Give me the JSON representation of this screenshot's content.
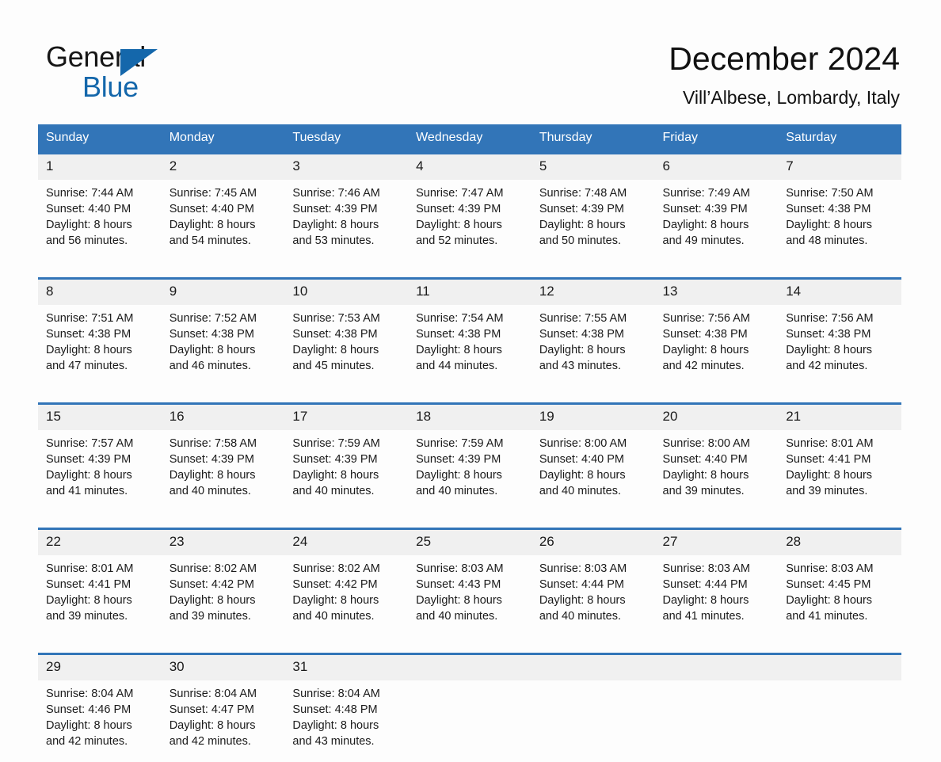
{
  "brand": {
    "word_one": "General",
    "word_two": "Blue",
    "triangle_icon": "triangle-icon",
    "accent_color": "#1467ab"
  },
  "header": {
    "title": "December 2024",
    "location": "Vill’Albese, Lombardy, Italy"
  },
  "theme": {
    "header_blue": "#3275b8",
    "daynum_band": "#f0f0f0",
    "page_background": "#fdfdfd",
    "text_color": "#1a1a1a"
  },
  "calendar": {
    "day_headers": [
      "Sunday",
      "Monday",
      "Tuesday",
      "Wednesday",
      "Thursday",
      "Friday",
      "Saturday"
    ],
    "weeks": [
      {
        "days": [
          {
            "date": "1",
            "sunrise": "Sunrise: 7:44 AM",
            "sunset": "Sunset: 4:40 PM",
            "daylight_line1": "Daylight: 8 hours",
            "daylight_line2": "and 56 minutes."
          },
          {
            "date": "2",
            "sunrise": "Sunrise: 7:45 AM",
            "sunset": "Sunset: 4:40 PM",
            "daylight_line1": "Daylight: 8 hours",
            "daylight_line2": "and 54 minutes."
          },
          {
            "date": "3",
            "sunrise": "Sunrise: 7:46 AM",
            "sunset": "Sunset: 4:39 PM",
            "daylight_line1": "Daylight: 8 hours",
            "daylight_line2": "and 53 minutes."
          },
          {
            "date": "4",
            "sunrise": "Sunrise: 7:47 AM",
            "sunset": "Sunset: 4:39 PM",
            "daylight_line1": "Daylight: 8 hours",
            "daylight_line2": "and 52 minutes."
          },
          {
            "date": "5",
            "sunrise": "Sunrise: 7:48 AM",
            "sunset": "Sunset: 4:39 PM",
            "daylight_line1": "Daylight: 8 hours",
            "daylight_line2": "and 50 minutes."
          },
          {
            "date": "6",
            "sunrise": "Sunrise: 7:49 AM",
            "sunset": "Sunset: 4:39 PM",
            "daylight_line1": "Daylight: 8 hours",
            "daylight_line2": "and 49 minutes."
          },
          {
            "date": "7",
            "sunrise": "Sunrise: 7:50 AM",
            "sunset": "Sunset: 4:38 PM",
            "daylight_line1": "Daylight: 8 hours",
            "daylight_line2": "and 48 minutes."
          }
        ]
      },
      {
        "days": [
          {
            "date": "8",
            "sunrise": "Sunrise: 7:51 AM",
            "sunset": "Sunset: 4:38 PM",
            "daylight_line1": "Daylight: 8 hours",
            "daylight_line2": "and 47 minutes."
          },
          {
            "date": "9",
            "sunrise": "Sunrise: 7:52 AM",
            "sunset": "Sunset: 4:38 PM",
            "daylight_line1": "Daylight: 8 hours",
            "daylight_line2": "and 46 minutes."
          },
          {
            "date": "10",
            "sunrise": "Sunrise: 7:53 AM",
            "sunset": "Sunset: 4:38 PM",
            "daylight_line1": "Daylight: 8 hours",
            "daylight_line2": "and 45 minutes."
          },
          {
            "date": "11",
            "sunrise": "Sunrise: 7:54 AM",
            "sunset": "Sunset: 4:38 PM",
            "daylight_line1": "Daylight: 8 hours",
            "daylight_line2": "and 44 minutes."
          },
          {
            "date": "12",
            "sunrise": "Sunrise: 7:55 AM",
            "sunset": "Sunset: 4:38 PM",
            "daylight_line1": "Daylight: 8 hours",
            "daylight_line2": "and 43 minutes."
          },
          {
            "date": "13",
            "sunrise": "Sunrise: 7:56 AM",
            "sunset": "Sunset: 4:38 PM",
            "daylight_line1": "Daylight: 8 hours",
            "daylight_line2": "and 42 minutes."
          },
          {
            "date": "14",
            "sunrise": "Sunrise: 7:56 AM",
            "sunset": "Sunset: 4:38 PM",
            "daylight_line1": "Daylight: 8 hours",
            "daylight_line2": "and 42 minutes."
          }
        ]
      },
      {
        "days": [
          {
            "date": "15",
            "sunrise": "Sunrise: 7:57 AM",
            "sunset": "Sunset: 4:39 PM",
            "daylight_line1": "Daylight: 8 hours",
            "daylight_line2": "and 41 minutes."
          },
          {
            "date": "16",
            "sunrise": "Sunrise: 7:58 AM",
            "sunset": "Sunset: 4:39 PM",
            "daylight_line1": "Daylight: 8 hours",
            "daylight_line2": "and 40 minutes."
          },
          {
            "date": "17",
            "sunrise": "Sunrise: 7:59 AM",
            "sunset": "Sunset: 4:39 PM",
            "daylight_line1": "Daylight: 8 hours",
            "daylight_line2": "and 40 minutes."
          },
          {
            "date": "18",
            "sunrise": "Sunrise: 7:59 AM",
            "sunset": "Sunset: 4:39 PM",
            "daylight_line1": "Daylight: 8 hours",
            "daylight_line2": "and 40 minutes."
          },
          {
            "date": "19",
            "sunrise": "Sunrise: 8:00 AM",
            "sunset": "Sunset: 4:40 PM",
            "daylight_line1": "Daylight: 8 hours",
            "daylight_line2": "and 40 minutes."
          },
          {
            "date": "20",
            "sunrise": "Sunrise: 8:00 AM",
            "sunset": "Sunset: 4:40 PM",
            "daylight_line1": "Daylight: 8 hours",
            "daylight_line2": "and 39 minutes."
          },
          {
            "date": "21",
            "sunrise": "Sunrise: 8:01 AM",
            "sunset": "Sunset: 4:41 PM",
            "daylight_line1": "Daylight: 8 hours",
            "daylight_line2": "and 39 minutes."
          }
        ]
      },
      {
        "days": [
          {
            "date": "22",
            "sunrise": "Sunrise: 8:01 AM",
            "sunset": "Sunset: 4:41 PM",
            "daylight_line1": "Daylight: 8 hours",
            "daylight_line2": "and 39 minutes."
          },
          {
            "date": "23",
            "sunrise": "Sunrise: 8:02 AM",
            "sunset": "Sunset: 4:42 PM",
            "daylight_line1": "Daylight: 8 hours",
            "daylight_line2": "and 39 minutes."
          },
          {
            "date": "24",
            "sunrise": "Sunrise: 8:02 AM",
            "sunset": "Sunset: 4:42 PM",
            "daylight_line1": "Daylight: 8 hours",
            "daylight_line2": "and 40 minutes."
          },
          {
            "date": "25",
            "sunrise": "Sunrise: 8:03 AM",
            "sunset": "Sunset: 4:43 PM",
            "daylight_line1": "Daylight: 8 hours",
            "daylight_line2": "and 40 minutes."
          },
          {
            "date": "26",
            "sunrise": "Sunrise: 8:03 AM",
            "sunset": "Sunset: 4:44 PM",
            "daylight_line1": "Daylight: 8 hours",
            "daylight_line2": "and 40 minutes."
          },
          {
            "date": "27",
            "sunrise": "Sunrise: 8:03 AM",
            "sunset": "Sunset: 4:44 PM",
            "daylight_line1": "Daylight: 8 hours",
            "daylight_line2": "and 41 minutes."
          },
          {
            "date": "28",
            "sunrise": "Sunrise: 8:03 AM",
            "sunset": "Sunset: 4:45 PM",
            "daylight_line1": "Daylight: 8 hours",
            "daylight_line2": "and 41 minutes."
          }
        ]
      },
      {
        "days": [
          {
            "date": "29",
            "sunrise": "Sunrise: 8:04 AM",
            "sunset": "Sunset: 4:46 PM",
            "daylight_line1": "Daylight: 8 hours",
            "daylight_line2": "and 42 minutes."
          },
          {
            "date": "30",
            "sunrise": "Sunrise: 8:04 AM",
            "sunset": "Sunset: 4:47 PM",
            "daylight_line1": "Daylight: 8 hours",
            "daylight_line2": "and 42 minutes."
          },
          {
            "date": "31",
            "sunrise": "Sunrise: 8:04 AM",
            "sunset": "Sunset: 4:48 PM",
            "daylight_line1": "Daylight: 8 hours",
            "daylight_line2": "and 43 minutes."
          },
          {
            "date": "",
            "sunrise": "",
            "sunset": "",
            "daylight_line1": "",
            "daylight_line2": ""
          },
          {
            "date": "",
            "sunrise": "",
            "sunset": "",
            "daylight_line1": "",
            "daylight_line2": ""
          },
          {
            "date": "",
            "sunrise": "",
            "sunset": "",
            "daylight_line1": "",
            "daylight_line2": ""
          },
          {
            "date": "",
            "sunrise": "",
            "sunset": "",
            "daylight_line1": "",
            "daylight_line2": ""
          }
        ]
      }
    ]
  }
}
